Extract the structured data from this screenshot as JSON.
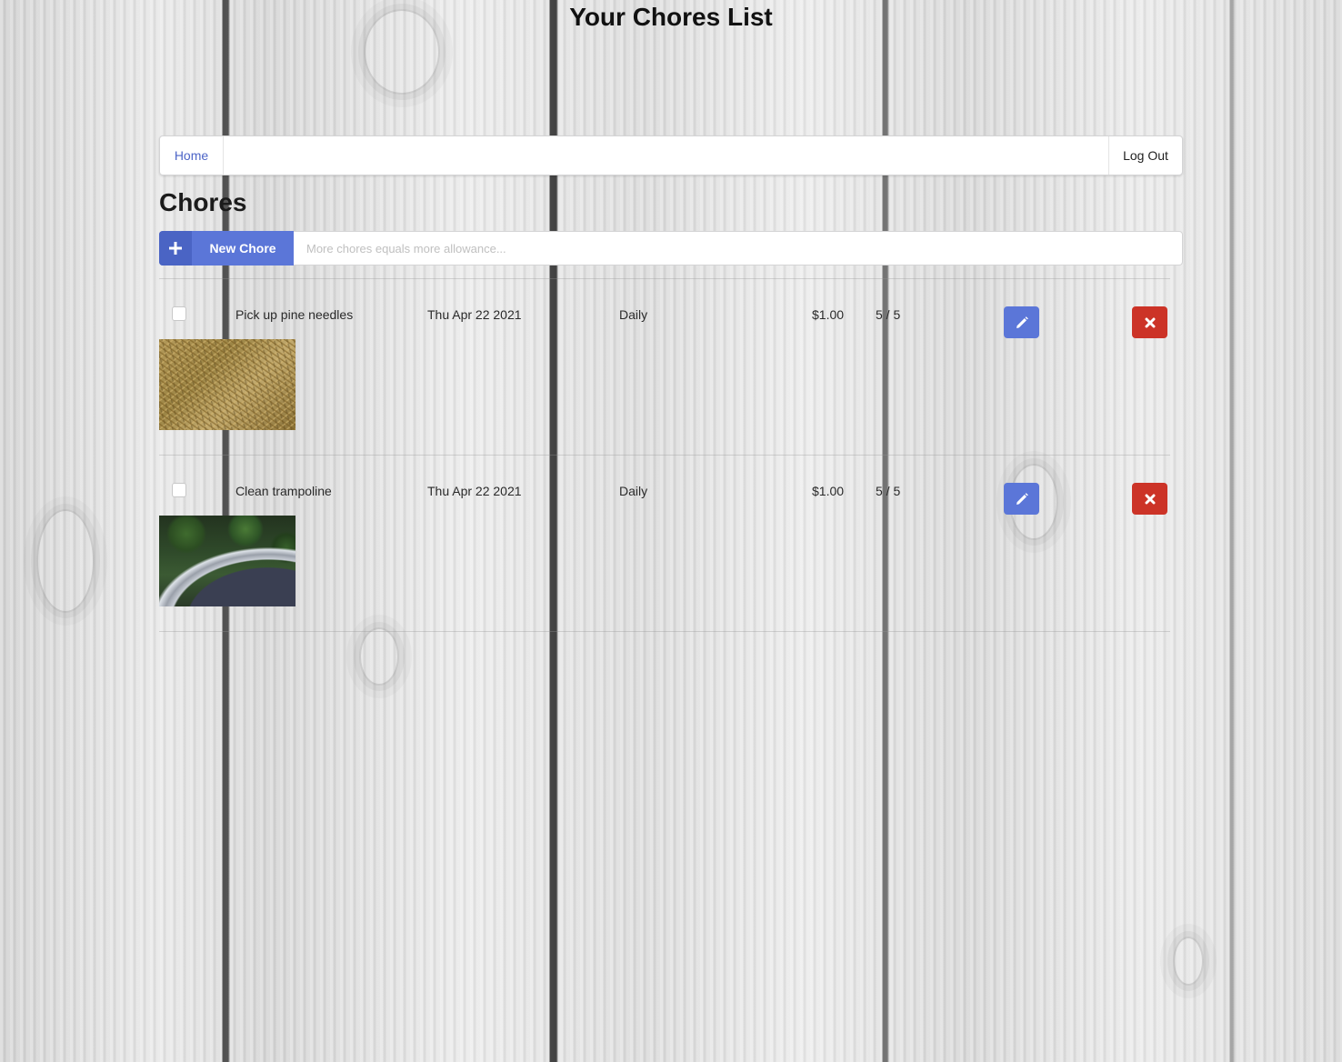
{
  "header": {
    "title": "Your Chores List"
  },
  "nav": {
    "home_label": "Home",
    "logout_label": "Log Out"
  },
  "section": {
    "title": "Chores"
  },
  "new_chore": {
    "button_label": "New Chore",
    "input_placeholder": "More chores equals more allowance...",
    "input_value": ""
  },
  "chores": [
    {
      "name": "Pick up pine needles",
      "date": "Thu Apr 22 2021",
      "frequency": "Daily",
      "reward": "$1.00",
      "count": "5 / 5",
      "checked": false,
      "image": "pine-needles"
    },
    {
      "name": "Clean trampoline",
      "date": "Thu Apr 22 2021",
      "frequency": "Daily",
      "reward": "$1.00",
      "count": "5 / 5",
      "checked": false,
      "image": "trampoline"
    }
  ],
  "icons": {
    "new": "plus-icon",
    "edit": "pencil-icon",
    "delete": "close-icon"
  },
  "colors": {
    "primary": "#5b76d8",
    "danger": "#cc3327",
    "link": "#4d65c7"
  }
}
